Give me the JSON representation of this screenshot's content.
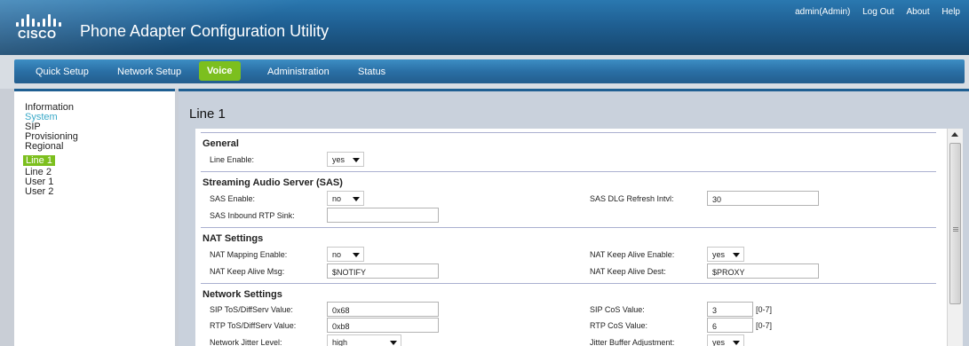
{
  "header": {
    "logo_text": "CISCO",
    "title": "Phone Adapter Configuration Utility",
    "user": "admin(Admin)",
    "links": [
      "Log Out",
      "About",
      "Help"
    ]
  },
  "nav": {
    "items": [
      "Quick Setup",
      "Network Setup",
      "Voice",
      "Administration",
      "Status"
    ],
    "active": "Voice"
  },
  "sidebar": {
    "items": [
      "Information",
      "System",
      "SIP",
      "Provisioning",
      "Regional",
      "Line 1",
      "Line 2",
      "User 1",
      "User 2"
    ],
    "active": "Line 1"
  },
  "main": {
    "title": "Line 1",
    "general": {
      "heading": "General",
      "line_enable_label": "Line Enable:",
      "line_enable_value": "yes"
    },
    "sas": {
      "heading": "Streaming Audio Server (SAS)",
      "enable_label": "SAS Enable:",
      "enable_value": "no",
      "refresh_label": "SAS DLG Refresh Intvl:",
      "refresh_value": "30",
      "sink_label": "SAS Inbound RTP Sink:",
      "sink_value": ""
    },
    "nat": {
      "heading": "NAT Settings",
      "mapping_label": "NAT Mapping Enable:",
      "mapping_value": "no",
      "keepalive_enable_label": "NAT Keep Alive Enable:",
      "keepalive_enable_value": "yes",
      "keepalive_msg_label": "NAT Keep Alive Msg:",
      "keepalive_msg_value": "$NOTIFY",
      "keepalive_dest_label": "NAT Keep Alive Dest:",
      "keepalive_dest_value": "$PROXY"
    },
    "network": {
      "heading": "Network Settings",
      "sip_tos_label": "SIP ToS/DiffServ Value:",
      "sip_tos_value": "0x68",
      "sip_cos_label": "SIP CoS Value:",
      "sip_cos_value": "3",
      "sip_cos_range": "[0-7]",
      "rtp_tos_label": "RTP ToS/DiffServ Value:",
      "rtp_tos_value": "0xb8",
      "rtp_cos_label": "RTP CoS Value:",
      "rtp_cos_value": "6",
      "rtp_cos_range": "[0-7]",
      "jitter_label": "Network Jitter Level:",
      "jitter_value": "high",
      "jitter_adj_label": "Jitter Buffer Adjustment:",
      "jitter_adj_value": "yes"
    }
  },
  "colors": {
    "header_blue": "#1f5f92",
    "active_green": "#7cbf1e",
    "section_teal": "#3aa9c8"
  }
}
